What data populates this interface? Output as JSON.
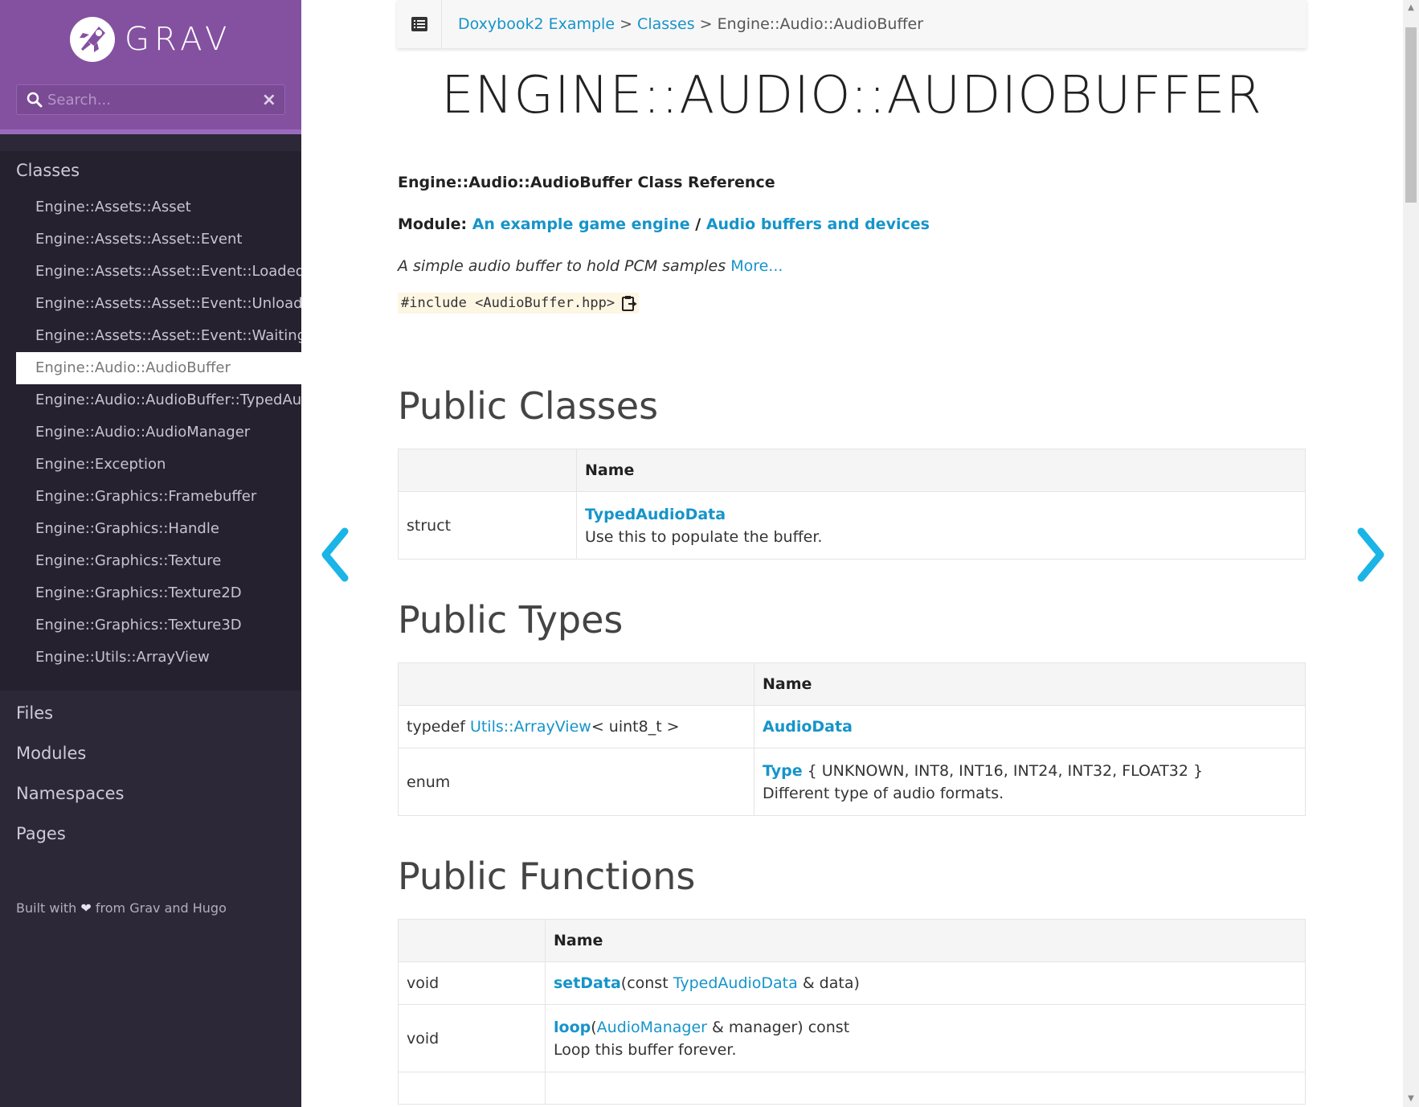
{
  "brand": {
    "logo_text": "GRAV"
  },
  "search": {
    "placeholder": "Search...",
    "clear_label": "×"
  },
  "sidebar": {
    "classes_title": "Classes",
    "classes": [
      "Engine::Assets::Asset",
      "Engine::Assets::Asset::Event",
      "Engine::Assets::Asset::Event::Loaded",
      "Engine::Assets::Asset::Event::Unloaded",
      "Engine::Assets::Asset::Event::Waiting",
      "Engine::Audio::AudioBuffer",
      "Engine::Audio::AudioBuffer::TypedAudioData",
      "Engine::Audio::AudioManager",
      "Engine::Exception",
      "Engine::Graphics::Framebuffer",
      "Engine::Graphics::Handle",
      "Engine::Graphics::Texture",
      "Engine::Graphics::Texture2D",
      "Engine::Graphics::Texture3D",
      "Engine::Utils::ArrayView"
    ],
    "active_index": 5,
    "sections": [
      "Files",
      "Modules",
      "Namespaces",
      "Pages"
    ],
    "footer": {
      "prefix": "Built with",
      "suffix": "from Grav and Hugo"
    }
  },
  "breadcrumb": {
    "items": [
      "Doxybook2 Example",
      "Classes",
      "Engine::Audio::AudioBuffer"
    ],
    "separator": ">"
  },
  "page": {
    "title": "ENGINE::AUDIO::AUDIOBUFFER",
    "class_reference": "Engine::Audio::AudioBuffer Class Reference",
    "module_label": "Module:",
    "module_links": [
      "An example game engine",
      "Audio buffers and devices"
    ],
    "module_separator": "/",
    "brief": "A simple audio buffer to hold PCM samples",
    "more_link": "More...",
    "include": "#include <AudioBuffer.hpp>"
  },
  "public_classes": {
    "heading": "Public Classes",
    "header": "Name",
    "rows": [
      {
        "kind": "struct",
        "name": "TypedAudioData",
        "desc": "Use this to populate the buffer."
      }
    ]
  },
  "public_types": {
    "heading": "Public Types",
    "header": "Name",
    "rows": [
      {
        "kind_prefix": "typedef ",
        "kind_link": "Utils::ArrayView",
        "kind_suffix": "< uint8_t >",
        "name": "AudioData",
        "name_suffix": "",
        "desc": ""
      },
      {
        "kind_prefix": "enum",
        "kind_link": "",
        "kind_suffix": "",
        "name": "Type",
        "name_suffix": " { UNKNOWN, INT8, INT16, INT24, INT32, FLOAT32 }",
        "desc": "Different type of audio formats."
      }
    ]
  },
  "public_functions": {
    "heading": "Public Functions",
    "header": "Name",
    "rows": [
      {
        "kind": "void",
        "name": "setData",
        "args_prefix": "(const ",
        "args_link": "TypedAudioData",
        "args_suffix": " & data)",
        "desc": ""
      },
      {
        "kind": "void",
        "name": "loop",
        "args_prefix": "(",
        "args_link": "AudioManager",
        "args_suffix": " & manager) const",
        "desc": "Loop this buffer forever."
      }
    ]
  },
  "colors": {
    "sidebar_header": "#8451a1",
    "sidebar_bg": "#2d2838",
    "link": "#1694ca",
    "arrow": "#1ab4e6"
  }
}
